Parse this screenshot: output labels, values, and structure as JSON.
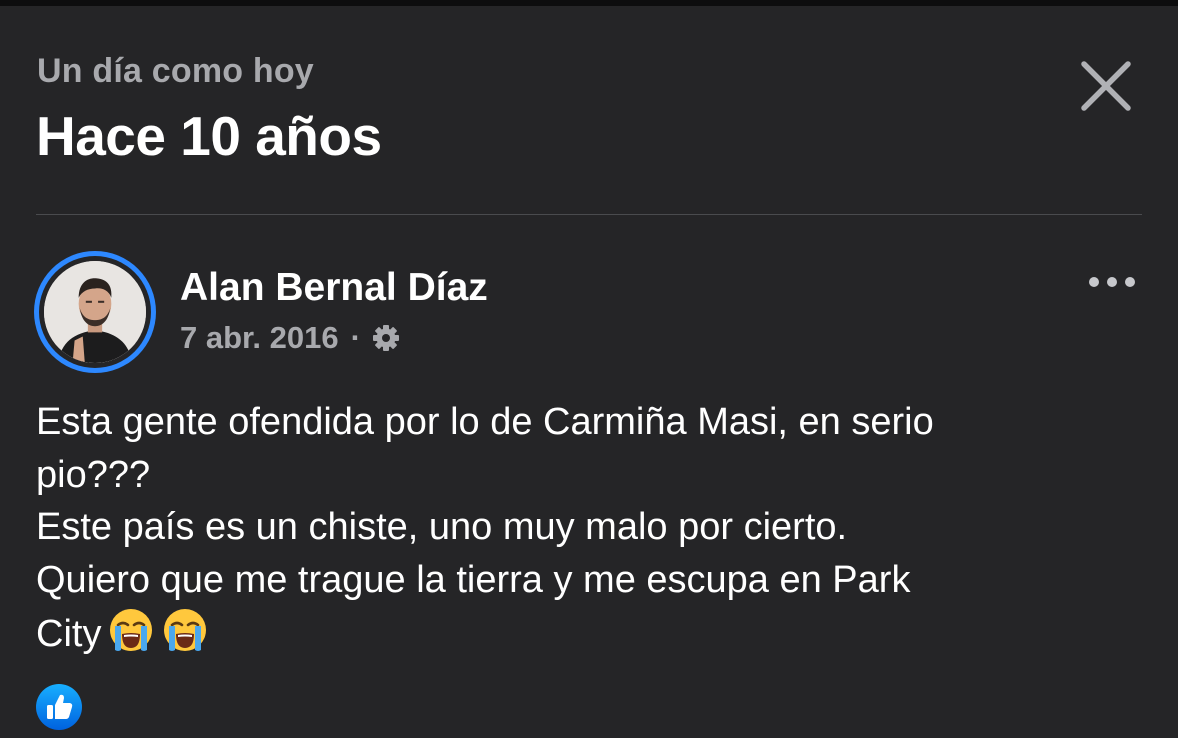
{
  "header": {
    "subtitle": "Un día como hoy",
    "title": "Hace 10 años",
    "close_icon": "close-icon"
  },
  "post": {
    "author": "Alan Bernal Díaz",
    "date": "7 abr. 2016",
    "separator": "·",
    "audience_icon": "gear-icon",
    "more_icon": "more-options-icon",
    "lines": [
      "Esta gente ofendida por lo de Carmiña Masi, en serio",
      "pio???",
      "Este país es un chiste, uno muy malo por cierto.",
      "Quiero que me trague la tierra y me escupa en Park",
      "City"
    ],
    "emojis": [
      "loudly-crying-face",
      "loudly-crying-face"
    ],
    "reaction_icon": "like-icon"
  },
  "colors": {
    "background": "#252527",
    "accent": "#2d88ff",
    "text_primary": "#ffffff",
    "text_secondary": "#a8a9ad"
  }
}
